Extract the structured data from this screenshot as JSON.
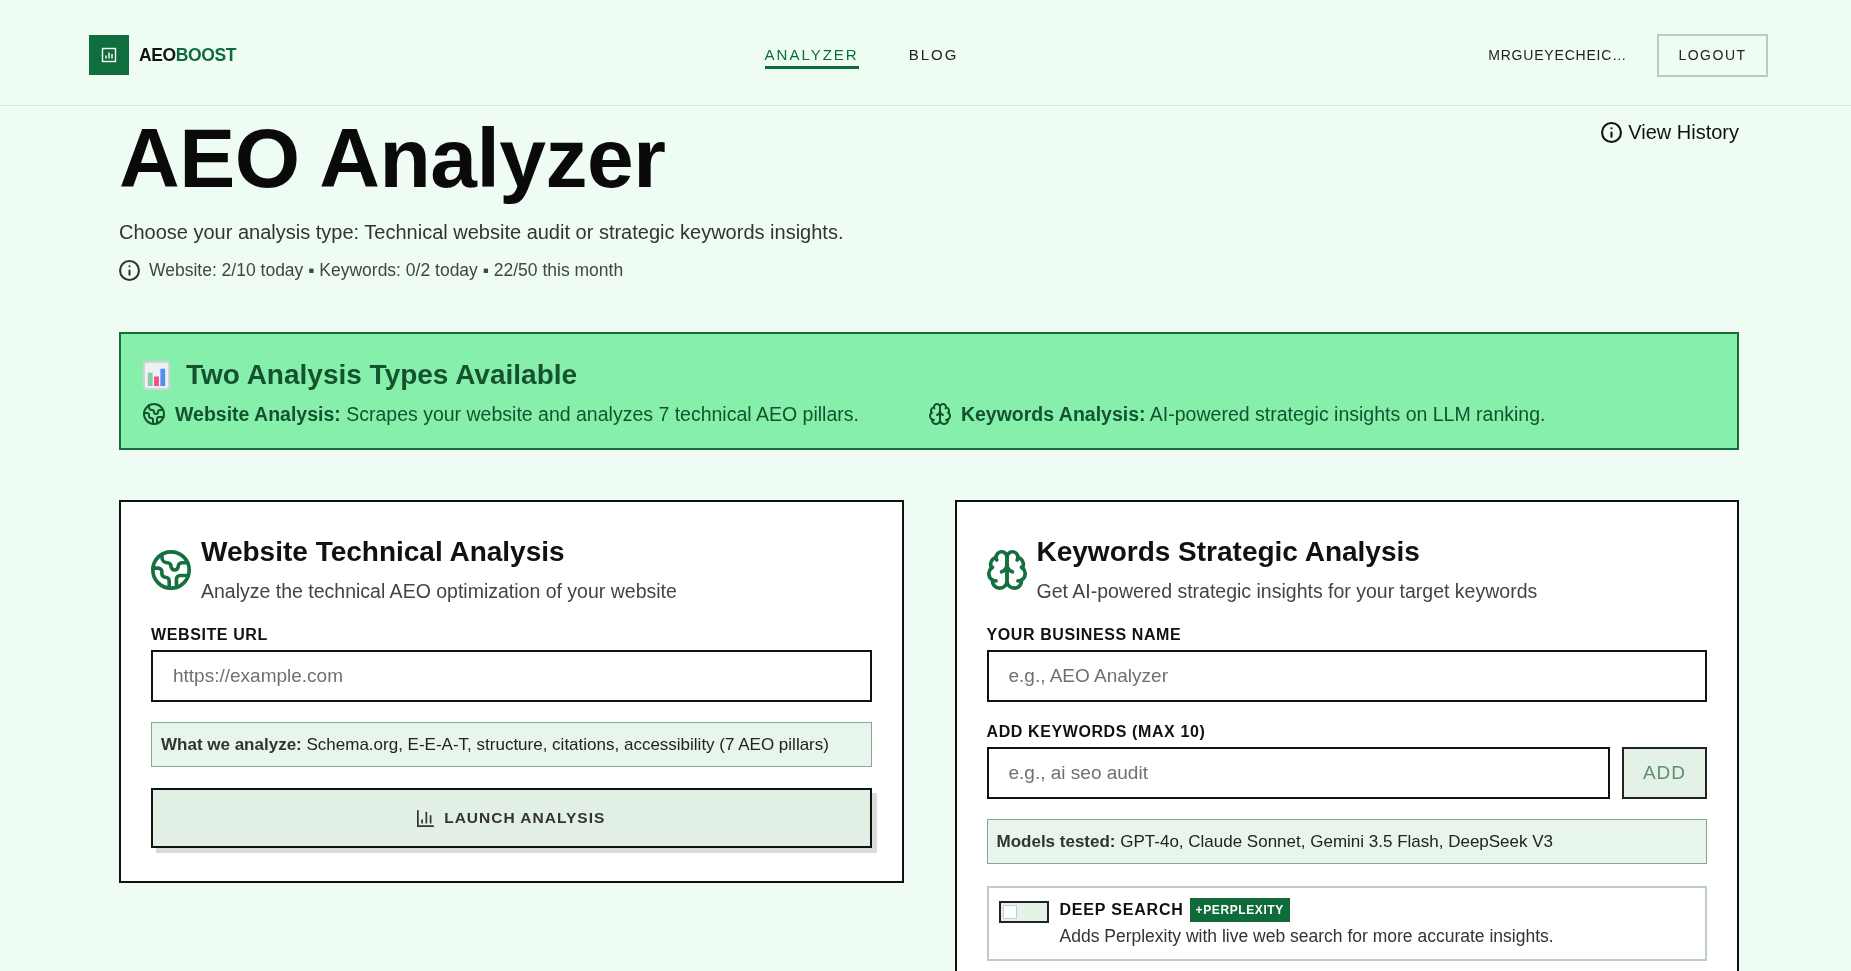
{
  "header": {
    "brand": {
      "dark_part": "AEO",
      "accent_part": "BOOST"
    },
    "nav": [
      {
        "label": "ANALYZER",
        "selected": true
      },
      {
        "label": "BLOG",
        "selected": false
      }
    ],
    "user": "MRGUEYECHEIC…",
    "logout_button": "LOGOUT"
  },
  "intro": {
    "title": "AEO Analyzer",
    "subtitle": "Choose your analysis type: Technical website audit or strategic keywords insights.",
    "usage": "Website: 2/10 today ▪ Keywords: 0/2 today ▪ 22/50 this month",
    "history_link": "View History"
  },
  "banner": {
    "title": "Two Analysis Types Available",
    "features": [
      {
        "kind": "website",
        "text": "**Website Analysis:** Scrapes your website and analyzes 7 technical AEO pillars."
      },
      {
        "kind": "keywords",
        "text": "**Keywords Analysis:** AI-powered strategic insights on LLM ranking."
      }
    ]
  },
  "cards": [
    {
      "kind": "website",
      "title": "Website Technical Analysis",
      "subtitle": "Analyze the technical AEO optimization of your website",
      "fields": [
        {
          "label": "WEBSITE URL",
          "placeholder": "https://example.com"
        }
      ],
      "note": "**What we analyze:** Schema.org, E-E-A-T, structure, citations, accessibility (7 AEO pillars)",
      "submit_button": "LAUNCH ANALYSIS"
    },
    {
      "kind": "keywords",
      "title": "Keywords Strategic Analysis",
      "subtitle": "Get AI-powered strategic insights for your target keywords",
      "fields": [
        {
          "label": "YOUR BUSINESS NAME",
          "placeholder": "e.g., AEO Analyzer"
        },
        {
          "label": "ADD KEYWORDS (MAX 10)",
          "placeholder": "e.g., ai seo audit",
          "add_button": {
            "label": "ADD",
            "disabled": true
          }
        }
      ],
      "note": "**Models tested:** GPT-4o, Claude Sonnet, Gemini 3.5 Flash, DeepSeek V3",
      "option": {
        "label": "DEEP SEARCH",
        "badge": "+PERPLEXITY",
        "description": "Adds Perplexity with live web search for more accurate insights.",
        "on": false
      }
    }
  ]
}
